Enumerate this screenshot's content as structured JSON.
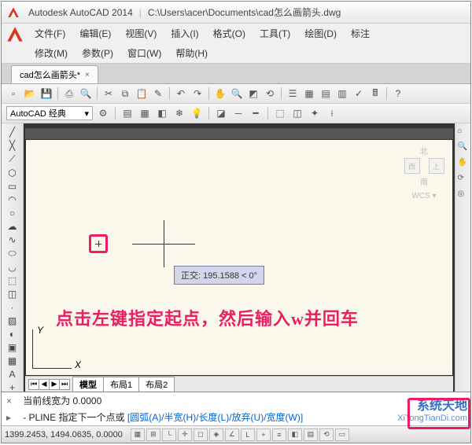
{
  "title": {
    "app": "Autodesk AutoCAD 2014",
    "path": "C:\\Users\\acer\\Documents\\cad怎么画箭头.dwg"
  },
  "menu": {
    "row1": [
      "文件(F)",
      "编辑(E)",
      "视图(V)",
      "插入(I)",
      "格式(O)",
      "工具(T)",
      "绘图(D)",
      "标注"
    ],
    "row2": [
      "修改(M)",
      "参数(P)",
      "窗口(W)",
      "帮助(H)"
    ]
  },
  "doc_tab": {
    "label": "cad怎么画箭头*",
    "close": "×"
  },
  "workspace": {
    "selected": "AutoCAD 经典",
    "dropdown": "▾"
  },
  "viewcube": {
    "north": "北",
    "top": "上",
    "west": "西",
    "south": "南",
    "wcs": "WCS ▾"
  },
  "tooltip": {
    "text": "正交: 195.1588 < 0°"
  },
  "instruction": {
    "text": "点击左键指定起点，然后输入w并回车"
  },
  "ucs": {
    "x": "X",
    "y": "Y"
  },
  "layout_tabs": {
    "nav": [
      "⏮",
      "◀",
      "▶",
      "⏭"
    ],
    "tabs": [
      "模型",
      "布局1",
      "布局2"
    ]
  },
  "command": {
    "line1": "当前线宽为  0.0000",
    "prompt_head": " - PLINE 指定下一个点或 ",
    "options": "[圆弧(A)/半宽(H)/长度(L)/放弃(U)/宽度(W)]"
  },
  "status": {
    "coords": "1399.2453, 1494.0635, 0.0000"
  },
  "watermark": {
    "line1": "系统天地",
    "line2": "XiTongTianDi.com"
  },
  "icons": {
    "toolbar1": [
      "new",
      "open",
      "save",
      "print",
      "undo",
      "redo",
      "cut",
      "copy",
      "paste",
      "match",
      "eraser",
      "zoom-ext",
      "zoom-win",
      "pan",
      "zoom",
      "3d",
      "render",
      "layer",
      "props",
      "dim",
      "table",
      "sel",
      "help"
    ],
    "toolbar2": [
      "ws-gear",
      "layers",
      "grid",
      "color",
      "line",
      "lweight",
      "style",
      "hatch",
      "block",
      "group",
      "purge",
      "audit"
    ],
    "left": [
      "line",
      "pline",
      "circle",
      "arc",
      "rect",
      "ellipse",
      "spline",
      "xline",
      "ray",
      "point",
      "hatch",
      "region",
      "table",
      "mtext",
      "block-insert",
      "make-block",
      "donut",
      "polygon",
      "boundary",
      "revcloud"
    ],
    "right": [
      "zoom-in",
      "zoom-out",
      "pan",
      "orbit",
      "steering"
    ]
  }
}
